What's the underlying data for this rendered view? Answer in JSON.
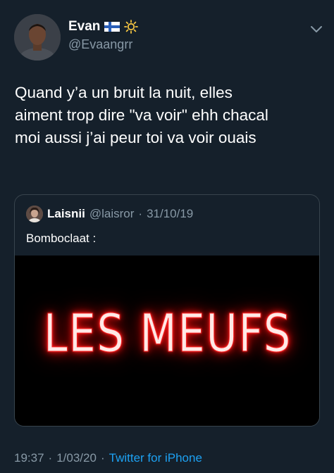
{
  "author": {
    "name": "Evan",
    "handle": "@Evaangrr"
  },
  "tweet": {
    "lines": [
      "Quand y’a un bruit la nuit, elles",
      "aiment trop dire \"va voir\" ehh chacal",
      "moi aussi j’ai peur toi va voir ouais"
    ]
  },
  "quoted": {
    "name": "Laisnii",
    "handle": "@laisror",
    "separator": "·",
    "date": "31/10/19",
    "text": "Bomboclaat :",
    "media_text": "LES MEUFS",
    "media_text_color": "#ff2a2a"
  },
  "footer": {
    "time": "19:37",
    "separator": "·",
    "date": "1/03/20",
    "source": "Twitter for iPhone"
  },
  "icons": {
    "flag": "finland-flag-icon",
    "weather": "sun-icon",
    "menu": "chevron-down-icon"
  },
  "colors": {
    "background": "#15202b",
    "secondary_text": "#8899a6",
    "link": "#1da1f2",
    "border": "#38444d"
  }
}
